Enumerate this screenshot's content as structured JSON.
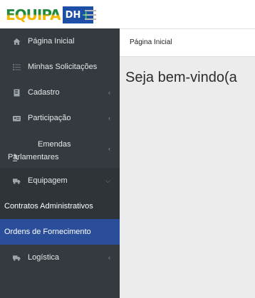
{
  "brand": {
    "name_part1": "EQUIPA",
    "name_part2": "DH",
    "plus": "+"
  },
  "sidebar": {
    "items": [
      {
        "label": "Página Inicial",
        "icon": "home-icon"
      },
      {
        "label": "Minhas Solicitações",
        "icon": "list-icon"
      },
      {
        "label": "Cadastro",
        "icon": "book-icon",
        "has_children": true
      },
      {
        "label": "Participação",
        "icon": "id-card-icon",
        "has_children": true
      },
      {
        "label": "Emendas Parlamentares",
        "icon": "gavel-icon",
        "has_children": true
      },
      {
        "label": "Equipagem",
        "icon": "truck-icon",
        "has_children": true,
        "expanded": true
      },
      {
        "label": "Logística",
        "icon": "truck-icon",
        "has_children": true
      }
    ],
    "equipagem_children": [
      {
        "label": "Contratos Administrativos",
        "active": false
      },
      {
        "label": "Ordens de Fornecimento",
        "active": true
      }
    ]
  },
  "breadcrumb": {
    "current": "Página Inicial"
  },
  "main": {
    "welcome": "Seja bem-vindo(a"
  },
  "colors": {
    "sidebar_bg": "#343a40",
    "active_bg": "#2a4e9a",
    "brand_green": "#1f8a3a",
    "brand_yellow": "#f5b800",
    "brand_blue": "#1e4fa8"
  }
}
